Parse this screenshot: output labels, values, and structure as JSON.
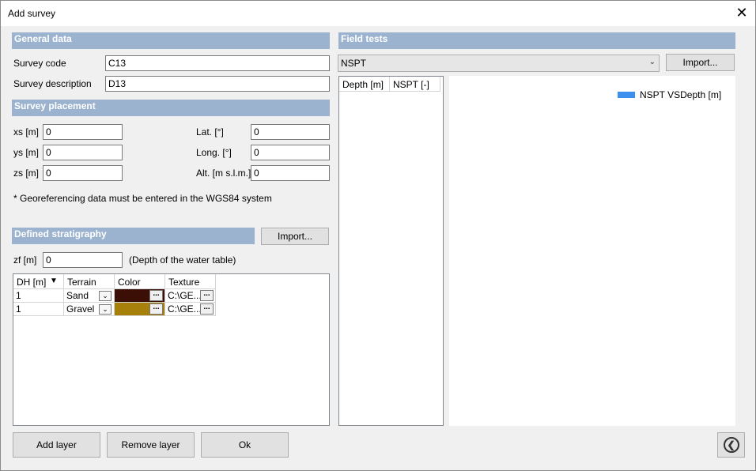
{
  "window": {
    "title": "Add survey",
    "close_glyph": "✕"
  },
  "general": {
    "header": "General data",
    "survey_code_label": "Survey code",
    "survey_code_value": "C13",
    "survey_description_label": "Survey description",
    "survey_description_value": "D13"
  },
  "placement": {
    "header": "Survey placement",
    "xs_label": "xs [m]",
    "xs_value": "0",
    "ys_label": "ys [m]",
    "ys_value": "0",
    "zs_label": "zs [m]",
    "zs_value": "0",
    "lat_label": "Lat. [°]",
    "lat_value": "0",
    "long_label": "Long. [°]",
    "long_value": "0",
    "alt_label": "Alt. [m s.l.m.]",
    "alt_value": "0",
    "note": "* Georeferencing data must be entered in the WGS84 system"
  },
  "stratigraphy": {
    "header": "Defined stratigraphy",
    "import_label": "Import...",
    "zf_label": "zf [m]",
    "zf_value": "0",
    "zf_note": "(Depth of the water table)",
    "columns": [
      "DH [m]",
      "Terrain",
      "Color",
      "Texture"
    ],
    "sort_glyph": "▼",
    "rows": [
      {
        "dh": "1",
        "terrain": "Sand",
        "color": "#3b0f05",
        "texture": "C:\\GE..."
      },
      {
        "dh": "1",
        "terrain": "Gravel",
        "color": "#a6800a",
        "texture": "C:\\GE..."
      }
    ],
    "dropdown_glyph": "⌄",
    "ellipsis": "..."
  },
  "field_tests": {
    "header": "Field tests",
    "selected_test": "NSPT",
    "dropdown_glyph": "⌄",
    "import_label": "Import...",
    "columns": [
      "Depth [m]",
      "NSPT [-]"
    ],
    "legend_label": "NSPT VSDepth [m]",
    "legend_color": "#3d8ff0"
  },
  "footer": {
    "add_layer": "Add layer",
    "remove_layer": "Remove layer",
    "ok": "Ok",
    "back_glyph": "❮"
  }
}
